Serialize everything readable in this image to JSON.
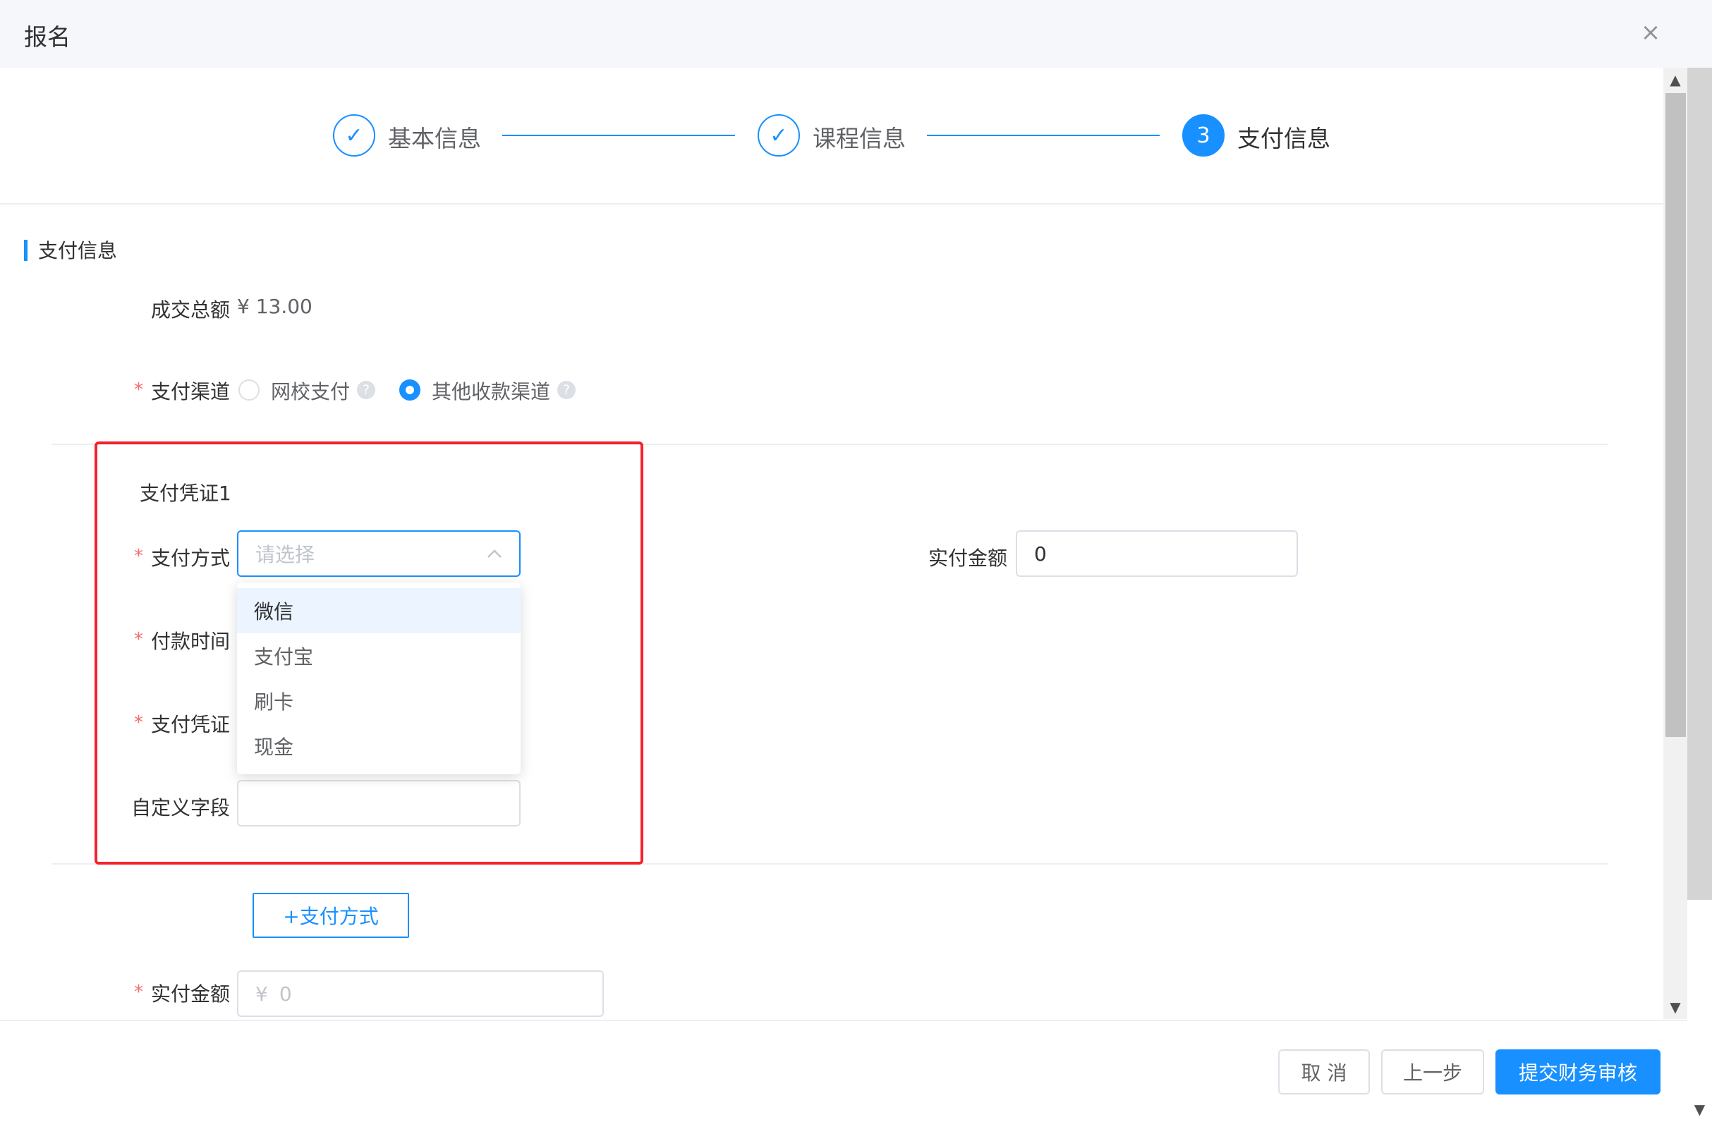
{
  "dialog": {
    "title": "报名",
    "close_icon": "×"
  },
  "steps": [
    {
      "label": "基本信息",
      "state": "done",
      "icon": "✓"
    },
    {
      "label": "课程信息",
      "state": "done",
      "icon": "✓"
    },
    {
      "label": "支付信息",
      "state": "active",
      "number": "3"
    }
  ],
  "section": {
    "title": "支付信息"
  },
  "summary": {
    "label": "成交总额",
    "value": "¥ 13.00"
  },
  "pay_channel": {
    "label": "支付渠道",
    "options": [
      {
        "label": "网校支付",
        "checked": false
      },
      {
        "label": "其他收款渠道",
        "checked": true
      }
    ]
  },
  "voucher": {
    "title": "支付凭证1",
    "method_label": "支付方式",
    "method_placeholder": "请选择",
    "time_label": "付款时间",
    "proof_label": "支付凭证",
    "custom_label": "自定义字段",
    "custom_value": "",
    "paid_label": "实付金额",
    "paid_value": "0",
    "dropdown_options": [
      "微信",
      "支付宝",
      "刷卡",
      "现金"
    ]
  },
  "add_method_button": "+支付方式",
  "total_paid": {
    "label": "实付金额",
    "prefix": "¥",
    "placeholder": "0"
  },
  "footer": {
    "cancel": "取 消",
    "prev": "上一步",
    "submit": "提交财务审核"
  },
  "colors": {
    "primary": "#1890ff",
    "required": "#f56c6c",
    "highlight_box": "#f5222d"
  },
  "scroll_arrows": {
    "up": "▲",
    "down": "▼"
  }
}
